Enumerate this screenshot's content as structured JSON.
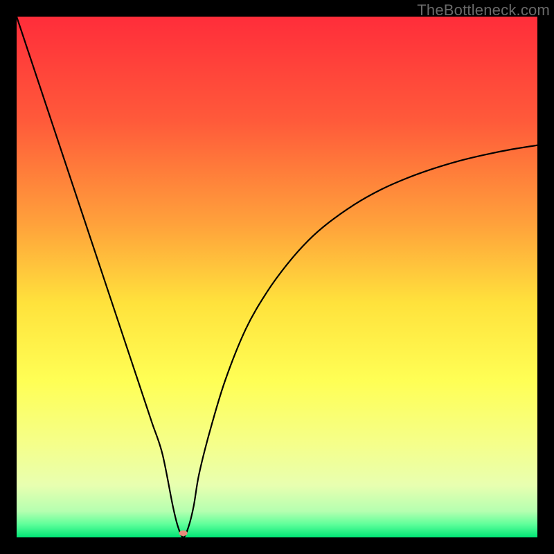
{
  "watermark": "TheBottleneck.com",
  "chart_data": {
    "type": "line",
    "title": "",
    "xlabel": "",
    "ylabel": "",
    "xlim": [
      0,
      100
    ],
    "ylim": [
      0,
      100
    ],
    "grid": false,
    "legend": false,
    "background_gradient": {
      "stops": [
        {
          "offset": 0.0,
          "color": "#ff2d3a"
        },
        {
          "offset": 0.2,
          "color": "#ff5a3a"
        },
        {
          "offset": 0.4,
          "color": "#ffa23b"
        },
        {
          "offset": 0.55,
          "color": "#ffe23c"
        },
        {
          "offset": 0.7,
          "color": "#ffff55"
        },
        {
          "offset": 0.82,
          "color": "#f5ff8a"
        },
        {
          "offset": 0.9,
          "color": "#e8ffb0"
        },
        {
          "offset": 0.95,
          "color": "#b5ffb0"
        },
        {
          "offset": 0.975,
          "color": "#5fff9a"
        },
        {
          "offset": 1.0,
          "color": "#00e676"
        }
      ]
    },
    "series": [
      {
        "name": "bottleneck-curve",
        "type": "line",
        "color": "#000000",
        "x": [
          0,
          2,
          4,
          6,
          8,
          10,
          12,
          14,
          16,
          18,
          20,
          22,
          24,
          26,
          28,
          30,
          31,
          32,
          33,
          34,
          35,
          37,
          40,
          44,
          48,
          52,
          56,
          60,
          65,
          70,
          75,
          80,
          85,
          90,
          95,
          100
        ],
        "y": [
          100,
          94,
          88,
          82,
          76,
          70,
          64,
          58,
          52,
          46,
          40,
          34,
          28,
          22,
          16,
          6,
          2,
          0,
          2,
          6,
          12,
          20,
          30,
          40,
          47,
          52.5,
          57,
          60.5,
          64,
          66.8,
          69,
          70.8,
          72.3,
          73.5,
          74.5,
          75.3
        ]
      }
    ],
    "markers": [
      {
        "name": "min-point-marker",
        "x": 32,
        "y": 0,
        "color": "#e98b7b",
        "rx": 6,
        "ry": 4
      }
    ]
  }
}
